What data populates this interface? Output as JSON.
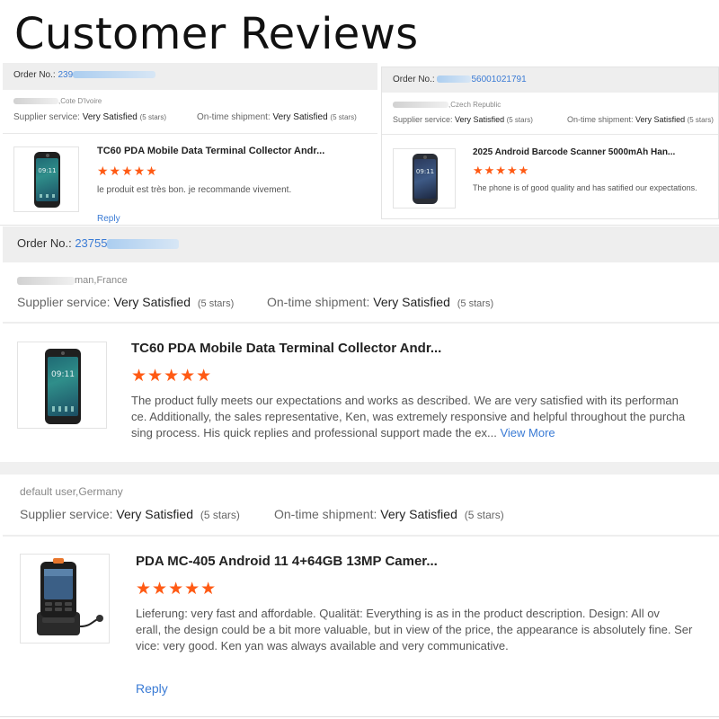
{
  "heading": "Customer Reviews",
  "colors": {
    "accent": "#3a7bd5",
    "stars": "#ff5a14",
    "order_bar": "#eeeeee"
  },
  "labels": {
    "order_no": "Order No.:",
    "supplier_service": "Supplier service:",
    "ontime_shipment": "On-time shipment:",
    "very_satisfied": "Very Satisfied",
    "five_stars": "(5 stars)",
    "reply": "Reply",
    "view_more": "View More",
    "stars": "★★★★★"
  },
  "review1": {
    "order_no": "239",
    "buyer": ",Cote D'Ivoire",
    "product_title": "TC60 PDA Mobile Data Terminal Collector Andr...",
    "text": "le produit est très bon. je recommande vivement.",
    "thumb_icon": "smartphone-icon",
    "clock": "09:11"
  },
  "review2": {
    "order_no": "56001021791",
    "buyer": ",Czech Republic",
    "product_title": "2025 Android Barcode Scanner 5000mAh Han...",
    "text": "The phone is of good quality and has satified our expectations.",
    "thumb_icon": "smartphone-icon",
    "clock": "09:11"
  },
  "review3": {
    "order_no": "23755",
    "buyer": "man,France",
    "product_title": "TC60 PDA Mobile Data Terminal Collector Andr...",
    "text_lines": [
      "The product fully meets our expectations and works as described. We are very satisfied with its performan",
      "ce. Additionally, the sales representative, Ken, was extremely responsive and helpful throughout the purcha",
      "sing process. His quick replies and professional support made the ex..."
    ],
    "thumb_icon": "smartphone-icon",
    "clock": "09:11"
  },
  "review4": {
    "buyer": "default user,Germany",
    "product_title": "PDA MC-405 Android 11 4+64GB 13MP Camer...",
    "text_lines": [
      "Lieferung:  very fast and affordable. Qualität:  Everything is as in the product description. Design:  All ov",
      "erall, the design could be a bit more valuable, but in view of the price, the appearance is absolutely fine. Ser",
      "vice:  very good. Ken yan was always available and very communicative."
    ],
    "thumb_icon": "handheld-scanner-cradle-icon"
  }
}
